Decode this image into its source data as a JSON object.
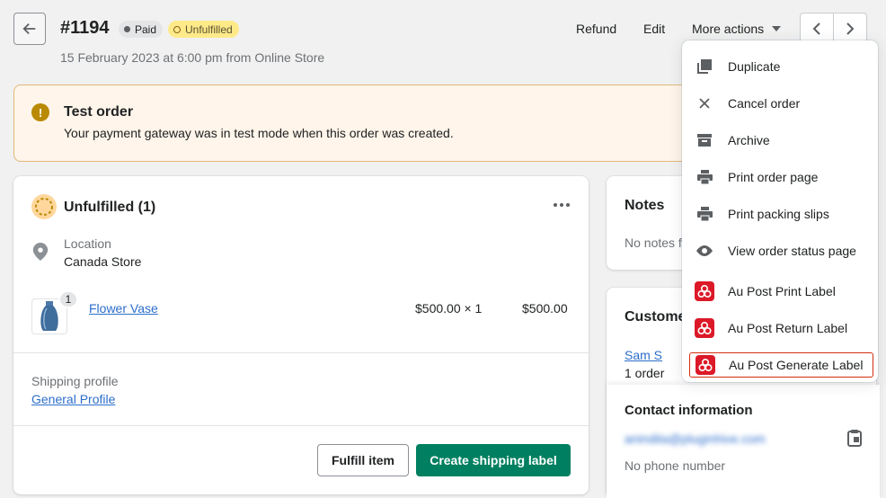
{
  "header": {
    "order_number": "#1194",
    "badges": {
      "paid": "Paid",
      "unfulfilled": "Unfulfilled"
    },
    "subtitle": "15 February 2023 at 6:00 pm from Online Store",
    "actions": {
      "refund": "Refund",
      "edit": "Edit",
      "more": "More actions"
    }
  },
  "banner": {
    "title": "Test order",
    "text": "Your payment gateway was in test mode when this order was created."
  },
  "fulfillment": {
    "title": "Unfulfilled (1)",
    "location_label": "Location",
    "location_value": "Canada Store",
    "product": {
      "name": "Flower Vase",
      "quantity_badge": "1",
      "unit_price": "$500.00 × 1",
      "total": "$500.00"
    },
    "shipping_label": "Shipping profile",
    "shipping_link": "General Profile",
    "buttons": {
      "fulfill": "Fulfill item",
      "create_label": "Create shipping label"
    }
  },
  "notes": {
    "title": "Notes",
    "text": "No notes f"
  },
  "customer": {
    "title": "Custome",
    "name": "Sam S",
    "orders": "1 order",
    "contact_title": "Contact information",
    "email": "anindita@pluginhive.com",
    "phone": "No phone number"
  },
  "menu": {
    "items": [
      {
        "label": "Duplicate",
        "icon": "duplicate-icon"
      },
      {
        "label": "Cancel order",
        "icon": "close-icon"
      },
      {
        "label": "Archive",
        "icon": "archive-icon"
      },
      {
        "label": "Print order page",
        "icon": "printer-icon"
      },
      {
        "label": "Print packing slips",
        "icon": "printer-icon"
      },
      {
        "label": "View order status page",
        "icon": "eye-icon"
      },
      {
        "label": "Au Post Print Label",
        "icon": "aupost-icon"
      },
      {
        "label": "Au Post Return Label",
        "icon": "aupost-icon"
      },
      {
        "label": "Au Post Generate Label",
        "icon": "aupost-icon"
      }
    ]
  },
  "colors": {
    "primary": "#008060",
    "link": "#2c6ecb",
    "warning": "#b98900",
    "aupost": "#dc1928"
  }
}
